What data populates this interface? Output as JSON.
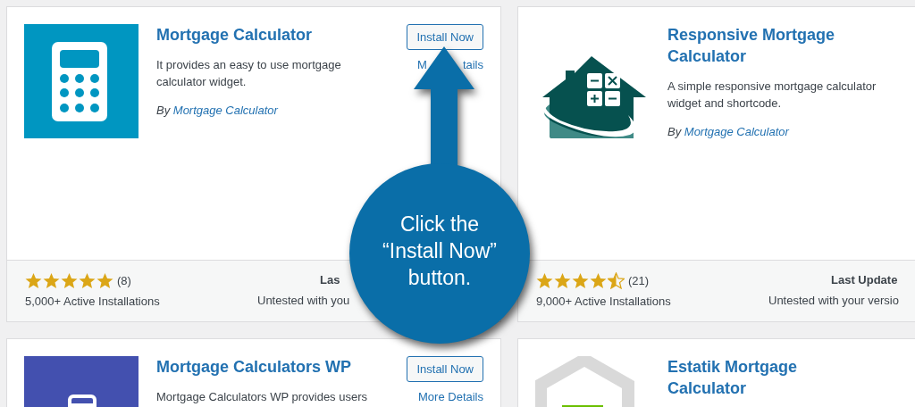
{
  "cards": [
    {
      "kind": "calculator",
      "title": "Mortgage Calculator",
      "install_button": "Install Now",
      "more_details": "M",
      "more_details_end": "tails",
      "description": "It provides an easy to use mortgage calculator widget.",
      "author_prefix": "By",
      "author": "Mortgage Calculator",
      "stars": 5,
      "rating_count": "(8)",
      "installs": "5,000+ Active Installations",
      "last_updated": "Las",
      "compatibility": "Untested with you"
    },
    {
      "kind": "house",
      "title": "Responsive Mortgage Calculator",
      "description": "A simple responsive mortgage calculator widget and shortcode.",
      "author_prefix": "By",
      "author": "Mortgage Calculator",
      "stars": 4.5,
      "rating_count": "(21)",
      "installs": "9,000+ Active Installations",
      "last_updated": "Last Update",
      "compatibility": "Untested with your versio"
    },
    {
      "kind": "window",
      "title": "Mortgage Calculators WP",
      "install_button": "Install Now",
      "more_details": "More Details",
      "description": "Mortgage Calculators WP provides users"
    },
    {
      "kind": "hexagon",
      "title": "Estatik Mortgage Calculator"
    }
  ],
  "callout": {
    "text": "Click the\n“Install Now”\nbutton."
  }
}
